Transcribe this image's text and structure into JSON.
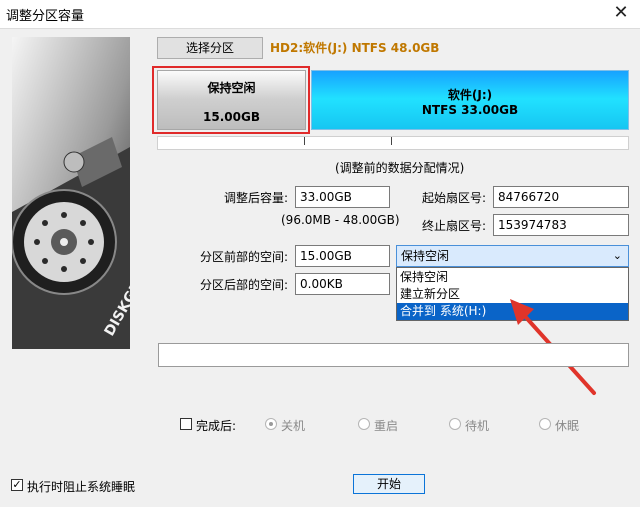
{
  "window": {
    "title": "调整分区容量",
    "close_glyph": "✕"
  },
  "brand_logo": "DISKGENIUS",
  "header": {
    "select_partition_label": "选择分区",
    "disk_info": "HD2:软件(J:) NTFS 48.0GB"
  },
  "partitions": [
    {
      "name": "保持空闲",
      "size": "15.00GB"
    },
    {
      "name": "软件(J:)",
      "size": "NTFS 33.00GB"
    }
  ],
  "caption": "(调整前的数据分配情况)",
  "form": {
    "adjusted_size_label": "调整后容量:",
    "adjusted_size_value": "33.00GB",
    "range_hint": "(96.0MB - 48.00GB)",
    "start_sector_label": "起始扇区号:",
    "start_sector_value": "84766720",
    "end_sector_label": "终止扇区号:",
    "end_sector_value": "153974783",
    "space_before_label": "分区前部的空间:",
    "space_before_value": "15.00GB",
    "space_after_label": "分区后部的空间:",
    "space_after_value": "0.00KB"
  },
  "combo": {
    "selected": "保持空闲",
    "options": [
      "保持空闲",
      "建立新分区",
      "合并到 系统(H:)"
    ],
    "highlighted_index": 2
  },
  "progress": {
    "value": 0
  },
  "after_complete": {
    "label": "完成后:",
    "options": [
      "关机",
      "重启",
      "待机",
      "休眠"
    ],
    "checked_option_index": 0
  },
  "prevent_sleep": {
    "label": "执行时阻止系统睡眠",
    "checked": true
  },
  "start_button": "开始",
  "colors": {
    "highlight_border": "#e02a2a",
    "partition_fill": "#21e1ff",
    "selection": "#0a64c8"
  }
}
